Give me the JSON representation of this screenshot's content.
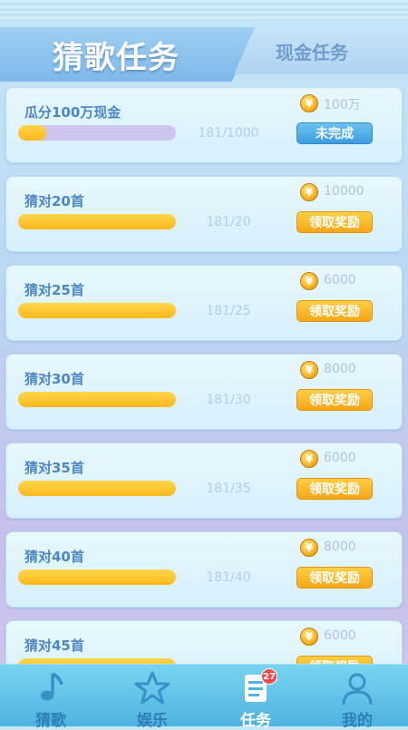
{
  "header": {
    "active_tab": "猜歌任务",
    "inactive_tab": "现金任务"
  },
  "tasks": [
    {
      "title": "瓜分100万现金",
      "progress_text": "181/1000",
      "progress_fraction": 0.181,
      "reward": "100万",
      "button": "未完成",
      "button_state": "incomplete"
    },
    {
      "title": "猜对20首",
      "progress_text": "181/20",
      "progress_fraction": 1.0,
      "reward": "10000",
      "button": "领取奖励",
      "button_state": "claim"
    },
    {
      "title": "猜对25首",
      "progress_text": "181/25",
      "progress_fraction": 1.0,
      "reward": "6000",
      "button": "领取奖励",
      "button_state": "claim"
    },
    {
      "title": "猜对30首",
      "progress_text": "181/30",
      "progress_fraction": 1.0,
      "reward": "8000",
      "button": "领取奖励",
      "button_state": "claim"
    },
    {
      "title": "猜对35首",
      "progress_text": "181/35",
      "progress_fraction": 1.0,
      "reward": "6000",
      "button": "领取奖励",
      "button_state": "claim"
    },
    {
      "title": "猜对40首",
      "progress_text": "181/40",
      "progress_fraction": 1.0,
      "reward": "8000",
      "button": "领取奖励",
      "button_state": "claim"
    },
    {
      "title": "猜对45首",
      "progress_text": "",
      "progress_fraction": 1.0,
      "reward": "6000",
      "button": "领取奖励",
      "button_state": "claim"
    }
  ],
  "nav": {
    "items": [
      {
        "label": "猜歌",
        "icon": "music-note-icon"
      },
      {
        "label": "娱乐",
        "icon": "star-icon"
      },
      {
        "label": "任务",
        "icon": "task-list-icon",
        "badge": "27",
        "active": true
      },
      {
        "label": "我的",
        "icon": "user-icon"
      }
    ]
  },
  "colors": {
    "progress_fill": "#ffc62e",
    "button_claim": "#f7a618",
    "button_incomplete": "#3c9de0",
    "nav_bg": "#4fb3e0",
    "badge": "#ef4b4b"
  }
}
